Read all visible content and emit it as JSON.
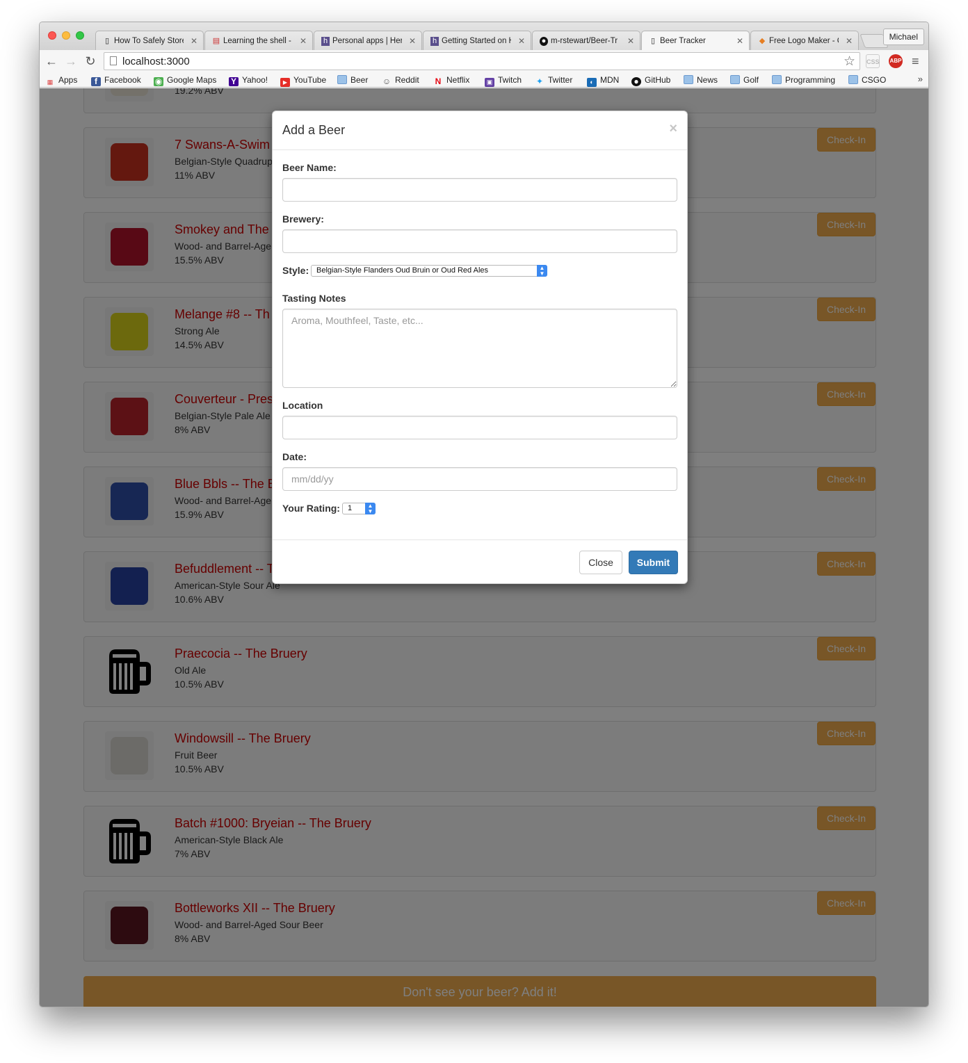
{
  "browser": {
    "tabs": [
      {
        "label": "How To Safely Store",
        "favicon": "page"
      },
      {
        "label": "Learning the shell - ",
        "favicon": "doc"
      },
      {
        "label": "Personal apps | Her",
        "favicon": "heroku"
      },
      {
        "label": "Getting Started on H",
        "favicon": "heroku"
      },
      {
        "label": "m-rstewart/Beer-Tr",
        "favicon": "github"
      },
      {
        "label": "Beer Tracker",
        "favicon": "page"
      },
      {
        "label": "Free Logo Maker - C",
        "favicon": "logo"
      }
    ],
    "profile_name": "Michael",
    "url": "localhost:3000",
    "extensions": {
      "css": "CSS",
      "abp": "ABP"
    },
    "bookmarks": [
      {
        "label": "Apps",
        "icon": "apps-grid-icon"
      },
      {
        "label": "Facebook",
        "icon": "facebook-icon"
      },
      {
        "label": "Google Maps",
        "icon": "maps-icon"
      },
      {
        "label": "Yahoo!",
        "icon": "yahoo-icon"
      },
      {
        "label": "YouTube",
        "icon": "youtube-icon"
      },
      {
        "label": "Beer",
        "icon": "folder-icon"
      },
      {
        "label": "Reddit",
        "icon": "reddit-icon"
      },
      {
        "label": "Netflix",
        "icon": "netflix-icon"
      },
      {
        "label": "Twitch",
        "icon": "twitch-icon"
      },
      {
        "label": "Twitter",
        "icon": "twitter-icon"
      },
      {
        "label": "MDN",
        "icon": "mdn-icon"
      },
      {
        "label": "GitHub",
        "icon": "github-icon"
      },
      {
        "label": "News",
        "icon": "folder-icon"
      },
      {
        "label": "Golf",
        "icon": "folder-icon"
      },
      {
        "label": "Programming",
        "icon": "folder-icon"
      },
      {
        "label": "CSGO",
        "icon": "folder-icon"
      }
    ],
    "bookmarks_overflow": "»"
  },
  "beers": [
    {
      "name": "",
      "style": "",
      "abv": "19.2% ABV",
      "image": "label",
      "label_color": "#e9e3d4"
    },
    {
      "name": "7 Swans-A-Swim",
      "style": "Belgian-Style Quadrup",
      "abv": "11% ABV",
      "image": "label",
      "label_color": "#c9301f"
    },
    {
      "name": "Smokey and The ",
      "style": "Wood- and Barrel-Age",
      "abv": "15.5% ABV",
      "image": "label",
      "label_color": "#b0122a"
    },
    {
      "name": "Melange #8 -- Th",
      "style": "Strong Ale",
      "abv": "14.5% ABV",
      "image": "label",
      "label_color": "#d8d21a"
    },
    {
      "name": "Couverteur - Pres",
      "style": "Belgian-Style Pale Ale",
      "abv": "8% ABV",
      "image": "label",
      "label_color": "#b8232b"
    },
    {
      "name": "Blue Bbls -- The B",
      "style": "Wood- and Barrel-Age",
      "abv": "15.9% ABV",
      "image": "label",
      "label_color": "#2f4fa8"
    },
    {
      "name": "Befuddlement -- T",
      "style": "American-Style Sour Ale",
      "abv": "10.6% ABV",
      "image": "label",
      "label_color": "#2740a0"
    },
    {
      "name": "Praecocia -- The Bruery",
      "style": "Old Ale",
      "abv": "10.5% ABV",
      "image": "mug"
    },
    {
      "name": "Windowsill -- The Bruery",
      "style": "Fruit Beer",
      "abv": "10.5% ABV",
      "image": "label",
      "label_color": "#d9d6d0"
    },
    {
      "name": "Batch #1000: Bryeian -- The Bruery",
      "style": "American-Style Black Ale",
      "abv": "7% ABV",
      "image": "mug"
    },
    {
      "name": "Bottleworks XII -- The Bruery",
      "style": "Wood- and Barrel-Aged Sour Beer",
      "abv": "8% ABV",
      "image": "label",
      "label_color": "#5a1620"
    }
  ],
  "checkin_label": "Check-In",
  "add_beer_label": "Don't see your beer? Add it!",
  "modal": {
    "title": "Add a Beer",
    "close_glyph": "×",
    "beer_name_label": "Beer Name:",
    "beer_name_value": "",
    "brewery_label": "Brewery:",
    "brewery_value": "",
    "style_label": "Style:",
    "style_value": "Belgian-Style Flanders Oud Bruin or Oud Red Ales",
    "tasting_label": "Tasting Notes",
    "tasting_placeholder": "Aroma, Mouthfeel, Taste, etc...",
    "location_label": "Location",
    "location_value": "",
    "date_label": "Date:",
    "date_placeholder": "mm/dd/yy",
    "rating_label": "Your Rating:",
    "rating_value": "1",
    "close_button": "Close",
    "submit_button": "Submit"
  },
  "colors": {
    "beer_name": "#cc0000",
    "checkin": "#f0ad4e",
    "submit": "#337ab7"
  }
}
